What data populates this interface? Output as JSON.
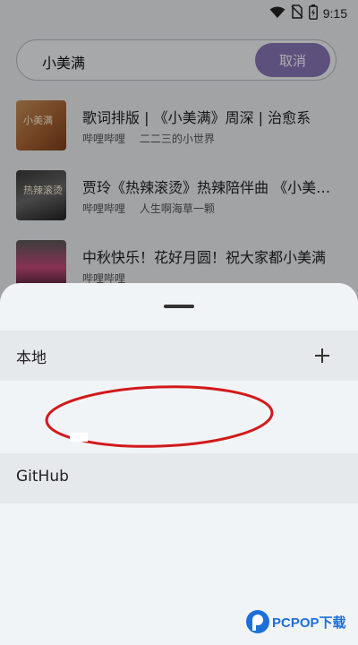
{
  "status_bar": {
    "time": "9:15",
    "icons": [
      "wifi-icon",
      "no-sim-icon",
      "battery-icon"
    ]
  },
  "search": {
    "query": "小美满",
    "cancel_label": "取消"
  },
  "results": [
    {
      "title": "歌词排版 | 《小美满》周深 | 治愈系",
      "uploader": "哔哩哔哩",
      "channel": "二二三的小世界",
      "thumb_text": "小美满"
    },
    {
      "title": "贾玲《热辣滚烫》热辣陪伴曲 《小美满》",
      "uploader": "哔哩哔哩",
      "channel": "人生啊海草一颗",
      "thumb_text": "热辣滚烫"
    },
    {
      "title": "中秋快乐！花好月圆！祝大家都小美满",
      "uploader": "哔哩哔哩",
      "channel": "",
      "thumb_text": ""
    }
  ],
  "sheet": {
    "local_label": "本地",
    "github_label": "GitHub"
  },
  "watermark": {
    "text": "PCPOP下载"
  },
  "colors": {
    "accent": "#8a77b8",
    "annotation": "#d11a1a"
  }
}
